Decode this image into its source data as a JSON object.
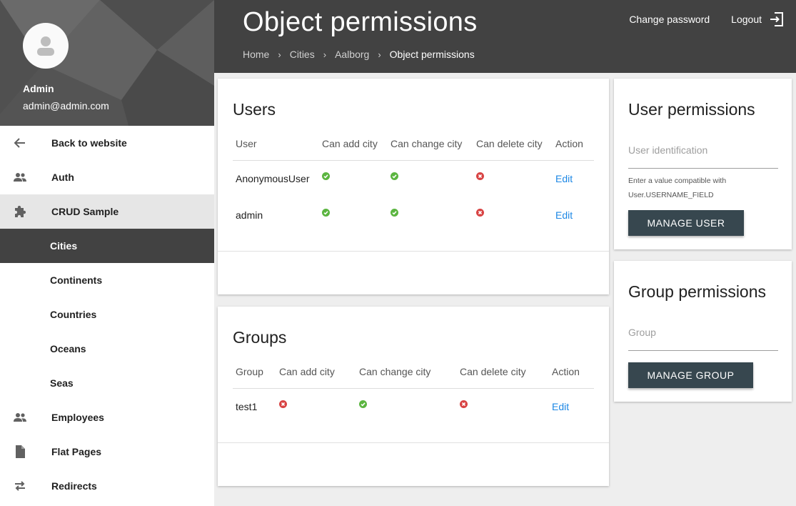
{
  "user": {
    "name": "Admin",
    "email": "admin@admin.com"
  },
  "header": {
    "title": "Object permissions",
    "breadcrumb": [
      "Home",
      "Cities",
      "Aalborg",
      "Object permissions"
    ],
    "change_password": "Change password",
    "logout": "Logout"
  },
  "sidebar": {
    "items": [
      {
        "label": "Back to website",
        "icon": "arrow-back-icon"
      },
      {
        "label": "Auth",
        "icon": "people-icon"
      },
      {
        "label": "CRUD Sample",
        "icon": "puzzle-icon"
      },
      {
        "label": "Cities"
      },
      {
        "label": "Continents"
      },
      {
        "label": "Countries"
      },
      {
        "label": "Oceans"
      },
      {
        "label": "Seas"
      },
      {
        "label": "Employees",
        "icon": "people-icon"
      },
      {
        "label": "Flat Pages",
        "icon": "file-icon"
      },
      {
        "label": "Redirects",
        "icon": "swap-icon"
      }
    ]
  },
  "users_card": {
    "title": "Users",
    "columns": [
      "User",
      "Can add city",
      "Can change city",
      "Can delete city",
      "Action"
    ],
    "rows": [
      {
        "name": "AnonymousUser",
        "perms": [
          true,
          true,
          false
        ],
        "action": "Edit"
      },
      {
        "name": "admin",
        "perms": [
          true,
          true,
          false
        ],
        "action": "Edit"
      }
    ]
  },
  "groups_card": {
    "title": "Groups",
    "columns": [
      "Group",
      "Can add city",
      "Can change city",
      "Can delete city",
      "Action"
    ],
    "rows": [
      {
        "name": "test1",
        "perms": [
          false,
          true,
          false
        ],
        "action": "Edit"
      }
    ]
  },
  "user_permissions": {
    "title": "User permissions",
    "placeholder": "User identification",
    "hint_line1": "Enter a value compatible with",
    "hint_line2": "User.USERNAME_FIELD",
    "button": "MANAGE USER"
  },
  "group_permissions": {
    "title": "Group permissions",
    "placeholder": "Group",
    "button": "MANAGE GROUP"
  },
  "colors": {
    "granted": "#5bb540",
    "denied": "#d84343",
    "link": "#1e88e5",
    "header_bg": "#424242",
    "button_bg": "#37474f"
  }
}
